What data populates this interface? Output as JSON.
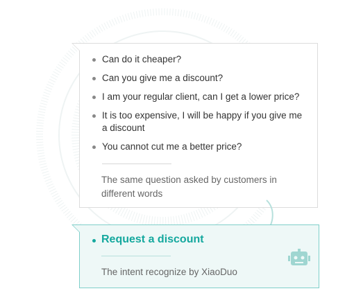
{
  "questions": [
    {
      "text": "Can do it cheaper?"
    },
    {
      "text": "Can you give me a discount?"
    },
    {
      "text": "I am your regular client, can I get a lower price?"
    },
    {
      "text": "It is too expensive, I will be happy if you give me a discount"
    },
    {
      "text": "You cannot cut me a better price?"
    }
  ],
  "questions_caption": "The same question asked by customers in different words",
  "intent": {
    "label": "Request a discount",
    "caption": "The intent recognize by XiaoDuo"
  },
  "colors": {
    "accent": "#14a89e",
    "accent_border": "#7fcfca",
    "accent_bg": "#eef8f7",
    "card_border": "#dcdcdc",
    "text": "#333333",
    "muted_text": "#666666"
  },
  "icons": {
    "arrow": "curved-arrow-down-icon",
    "robot": "robot-icon",
    "background": "concentric-rings-decoration"
  }
}
